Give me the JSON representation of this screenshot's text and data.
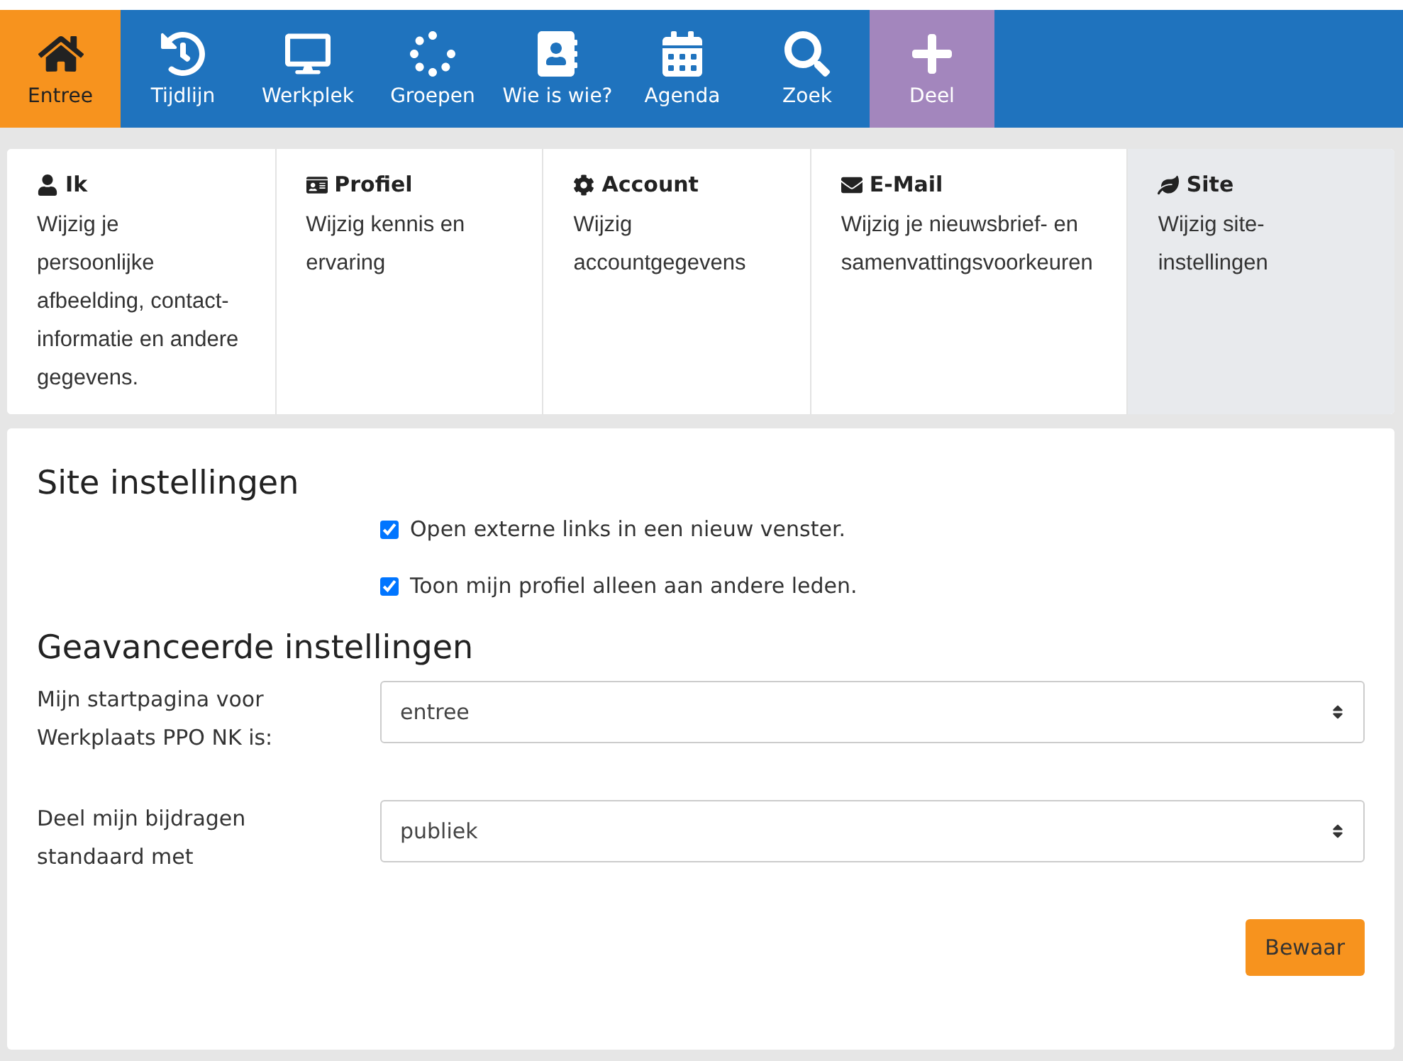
{
  "nav": [
    {
      "label": "Entree",
      "selected": true,
      "kind": "link"
    },
    {
      "label": "Tijdlijn",
      "selected": false,
      "kind": "link"
    },
    {
      "label": "Werkplek",
      "selected": false,
      "kind": "link"
    },
    {
      "label": "Groepen",
      "selected": false,
      "kind": "link"
    },
    {
      "label": "Wie is wie?",
      "selected": false,
      "kind": "link"
    },
    {
      "label": "Agenda",
      "selected": false,
      "kind": "link"
    },
    {
      "label": "Zoek",
      "selected": false,
      "kind": "link"
    },
    {
      "label": "Deel",
      "selected": false,
      "kind": "action"
    }
  ],
  "tabs": [
    {
      "title": "Ik",
      "description": "Wijzig je persoonlijke afbeelding, contact-informatie en andere gegevens.",
      "selected": false
    },
    {
      "title": "Profiel",
      "description": "Wijzig kennis en ervaring",
      "selected": false
    },
    {
      "title": "Account",
      "description": "Wijzig accountgegevens",
      "selected": false
    },
    {
      "title": "E-Mail",
      "description": "Wijzig je nieuwsbrief- en samenvattingsvoorkeuren",
      "selected": false
    },
    {
      "title": "Site",
      "description": "Wijzig site-instellingen",
      "selected": true
    }
  ],
  "site_settings": {
    "heading": "Site instellingen",
    "options": [
      {
        "label": "Open externe links in een nieuw venster.",
        "checked": true
      },
      {
        "label": "Toon mijn profiel alleen aan andere leden.",
        "checked": true
      }
    ]
  },
  "advanced_settings": {
    "heading": "Geavanceerde instellingen",
    "fields": [
      {
        "label": "Mijn startpagina voor Werkplaats PPO NK is:",
        "value": "entree"
      },
      {
        "label": "Deel mijn bijdragen standaard met",
        "value": "publiek"
      }
    ]
  },
  "save_button": "Bewaar"
}
